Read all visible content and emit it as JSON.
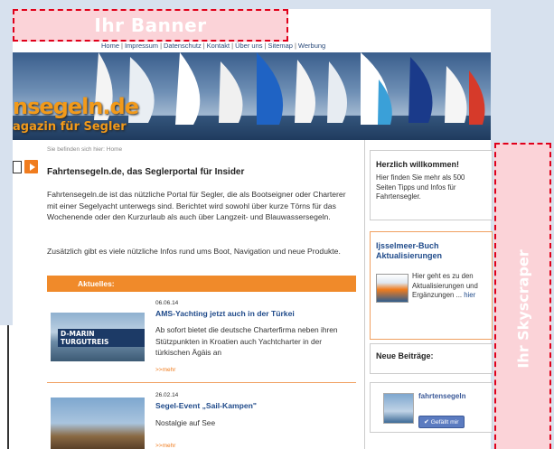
{
  "ads": {
    "banner_label": "Ihr Banner",
    "skyscraper_label": "Ihr Skyscraper"
  },
  "topnav": {
    "items": [
      "Home",
      "Impressum",
      "Datenschutz",
      "Kontakt",
      "Über uns",
      "Sitemap",
      "Werbung"
    ],
    "separator": "|"
  },
  "header": {
    "logo_main": "nsegeln.de",
    "logo_sub": "agazin für Segler"
  },
  "breadcrumb": "Sie befinden sich hier: Home",
  "main": {
    "title": "Fahrtensegeln.de, das Seglerportal für Insider",
    "paragraph1": "Fahrtensegeln.de ist das nützliche Portal für Segler, die als Bootseigner oder Charterer mit einer Segelyacht unterwegs sind. Berichtet wird sowohl über kurze Törns für das Wochenende oder den Kurzurlaub als auch über Langzeit- und Blauwassersegeln.",
    "paragraph2": "Zusätzlich gibt es viele nützliche Infos rund ums Boot, Navigation und neue Produkte.",
    "aktuelles_label": "Aktuelles:"
  },
  "news": [
    {
      "date": "06.06.14",
      "headline": "AMS-Yachting jetzt auch in der Türkei",
      "teaser": "Ab sofort bietet die deutsche Charterfirma neben ihren Stützpunkten in Kroatien auch Yachtcharter in der türkischen Ägäis an",
      "more": ">>mehr",
      "thumb_label": "D-MARIN TURGUTREIS"
    },
    {
      "date": "26.02.14",
      "headline": "Segel-Event „Sail-Kampen\"",
      "teaser": "Nostalgie auf See",
      "more": ">>mehr"
    }
  ],
  "sidebar": {
    "welcome_title": "Herzlich willkommen!",
    "welcome_text": "Hier finden Sie mehr als 500 Seiten Tipps und Infos für Fahrtensegler.",
    "buch_title": "Ijsselmeer-Buch Aktualisierungen",
    "buch_text": "Hier geht es zu den Aktualisierungen und Ergänzungen ...",
    "buch_link": "hier",
    "neue_title": "Neue Beiträge:",
    "fb_name": "fahrtensegeln",
    "fb_like": "Gefällt mir"
  },
  "colors": {
    "accent_orange": "#f08a2a",
    "link_blue": "#1f4a8a",
    "ad_red": "#e0001a",
    "ad_fill": "#fbd3d8"
  }
}
